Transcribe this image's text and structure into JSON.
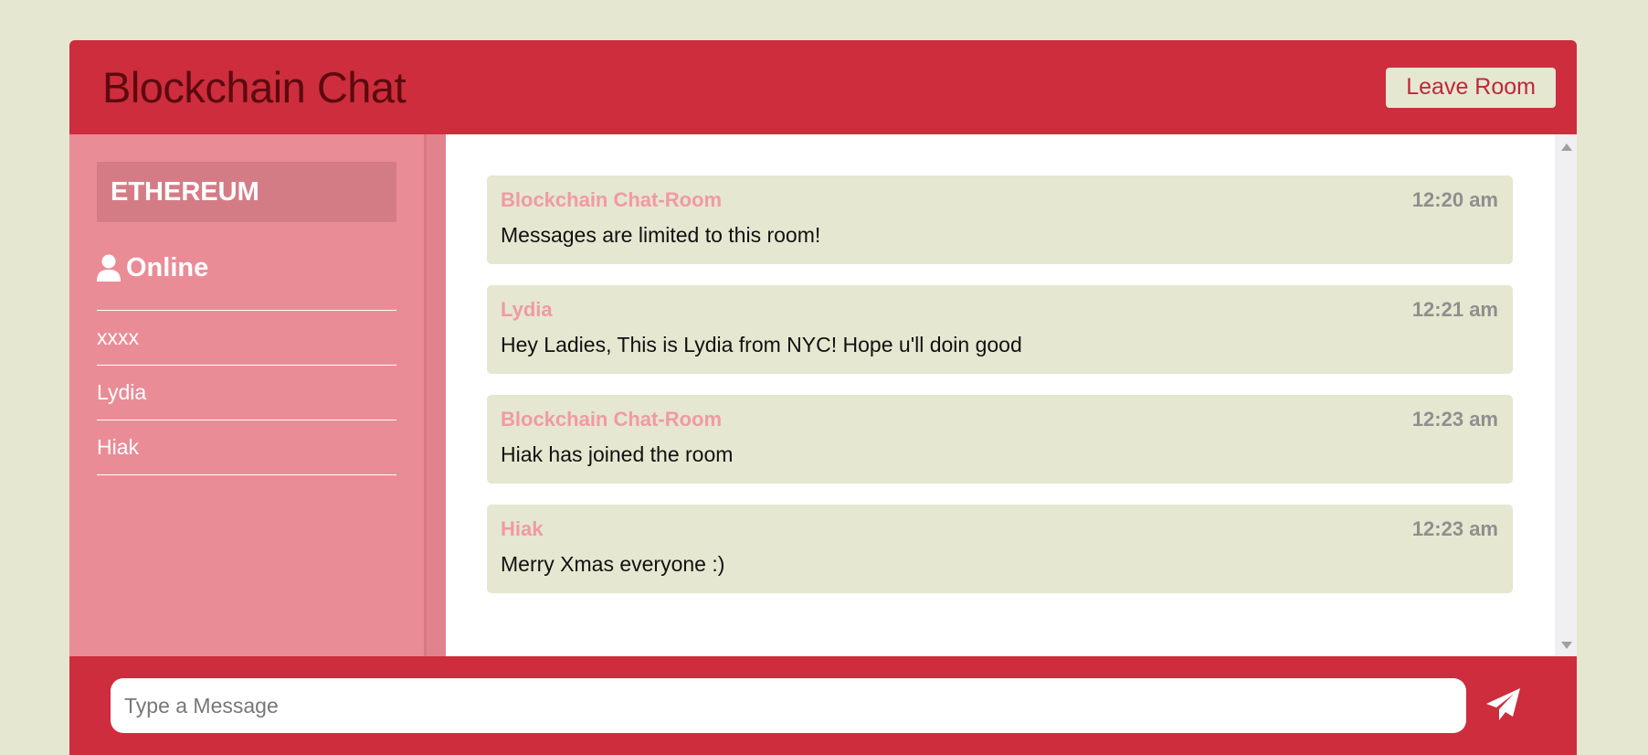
{
  "header": {
    "title": "Blockchain Chat",
    "leave_label": "Leave Room"
  },
  "sidebar": {
    "room_name": "ETHEREUM",
    "online_label": "Online",
    "online_icon": "user-icon",
    "users": [
      "xxxx",
      "Lydia",
      "Hiak"
    ]
  },
  "messages": [
    {
      "sender": "Blockchain Chat-Room",
      "time": "12:20 am",
      "text": "Messages are limited to this room!"
    },
    {
      "sender": "Lydia",
      "time": "12:21 am",
      "text": "Hey Ladies, This is Lydia from NYC! Hope u'll doin good"
    },
    {
      "sender": "Blockchain Chat-Room",
      "time": "12:23 am",
      "text": "Hiak has joined the room"
    },
    {
      "sender": "Hiak",
      "time": "12:23 am",
      "text": "Merry Xmas everyone :)"
    }
  ],
  "form": {
    "placeholder": "Type a Message",
    "send_icon": "paper-plane-icon"
  },
  "colors": {
    "page_background": "#e5e7d0",
    "brand_red": "#cd2d3c",
    "sidebar_pink": "#ea8c96",
    "sender_pink": "#f09aa4"
  }
}
